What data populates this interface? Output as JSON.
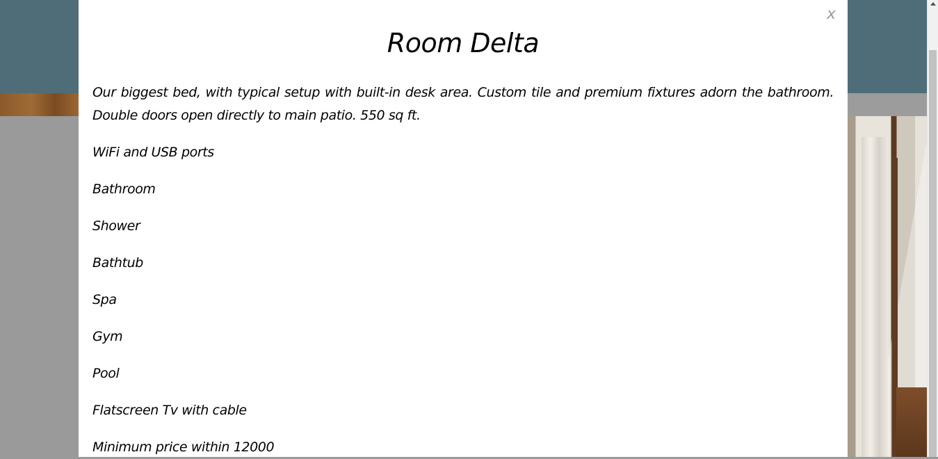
{
  "modal": {
    "close_label": "x",
    "title": "Room Delta",
    "description": "Our biggest bed, with typical setup with built-in desk area. Custom tile and premium fixtures adorn the bathroom. Double doors open directly to main patio. 550 sq ft.",
    "amenities": [
      "WiFi and USB ports",
      "Bathroom",
      "Shower",
      "Bathtub",
      "Spa",
      "Gym",
      "Pool",
      "Flatscreen Tv with cable",
      "Minimum price within 12000"
    ]
  },
  "colors": {
    "header_bg": "#4f6d78",
    "overlay": "#9a9a9a",
    "modal_bg": "#ffffff",
    "close": "#9a9a9a"
  }
}
